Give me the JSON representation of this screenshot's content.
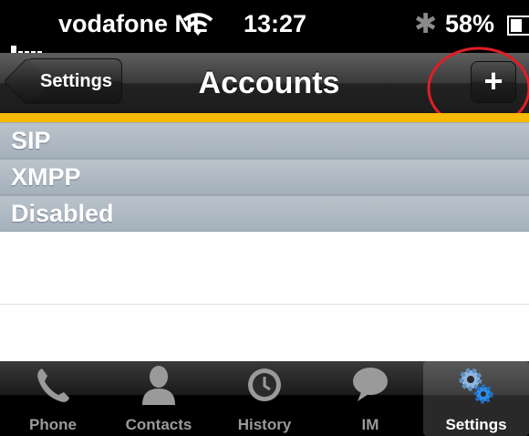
{
  "status_bar": {
    "carrier": "vodafone NL",
    "time": "13:27",
    "battery_percent": "58%",
    "battery_level": 0.58,
    "icons": [
      "signal-icon",
      "wifi-icon",
      "bluetooth-icon",
      "battery-icon"
    ]
  },
  "navbar": {
    "back_label": "Settings",
    "title": "Accounts",
    "add_label": "+"
  },
  "accent_color": "#f6b906",
  "annotation_color": "#e01e26",
  "sections": [
    {
      "label": "SIP"
    },
    {
      "label": "XMPP"
    },
    {
      "label": "Disabled"
    }
  ],
  "tabs": [
    {
      "label": "Phone",
      "icon": "phone-icon",
      "active": false
    },
    {
      "label": "Contacts",
      "icon": "contacts-icon",
      "active": false
    },
    {
      "label": "History",
      "icon": "clock-icon",
      "active": false
    },
    {
      "label": "IM",
      "icon": "chat-bubble-icon",
      "active": false
    },
    {
      "label": "Settings",
      "icon": "gears-icon",
      "active": true
    }
  ]
}
